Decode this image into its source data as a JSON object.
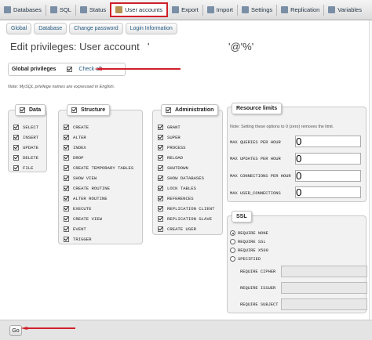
{
  "nav": {
    "tabs": [
      {
        "label": "Databases",
        "icon": "database-icon"
      },
      {
        "label": "SQL",
        "icon": "sql-icon"
      },
      {
        "label": "Status",
        "icon": "status-icon"
      },
      {
        "label": "User accounts",
        "icon": "user-icon"
      },
      {
        "label": "Export",
        "icon": "export-icon"
      },
      {
        "label": "Import",
        "icon": "import-icon"
      },
      {
        "label": "Settings",
        "icon": "wrench-icon"
      },
      {
        "label": "Replication",
        "icon": "replication-icon"
      },
      {
        "label": "Variables",
        "icon": "variables-icon"
      }
    ],
    "active_tab": "User accounts",
    "highlight_color": "#d0202a"
  },
  "subtabs": [
    "Global",
    "Database",
    "Change password",
    "Login Information"
  ],
  "page": {
    "title": "Edit privileges: User account",
    "quote_open": "'",
    "host_part": "'@'%'"
  },
  "global": {
    "label": "Global privileges",
    "check_all": "Check all",
    "note": "Note: MySQL privilege names are expressed in English."
  },
  "groups": {
    "data": {
      "legend": "Data",
      "items": [
        "SELECT",
        "INSERT",
        "UPDATE",
        "DELETE",
        "FILE"
      ]
    },
    "structure": {
      "legend": "Structure",
      "items": [
        "CREATE",
        "ALTER",
        "INDEX",
        "DROP",
        "CREATE TEMPORARY TABLES",
        "SHOW VIEW",
        "CREATE ROUTINE",
        "ALTER ROUTINE",
        "EXECUTE",
        "CREATE VIEW",
        "EVENT",
        "TRIGGER"
      ]
    },
    "administration": {
      "legend": "Administration",
      "items": [
        "GRANT",
        "SUPER",
        "PROCESS",
        "RELOAD",
        "SHUTDOWN",
        "SHOW DATABASES",
        "LOCK TABLES",
        "REFERENCES",
        "REPLICATION CLIENT",
        "REPLICATION SLAVE",
        "CREATE USER"
      ]
    }
  },
  "resource_limits": {
    "legend": "Resource limits",
    "note": "Note: Setting these options to 0 (zero) removes the limit.",
    "rows": [
      "MAX QUERIES PER HOUR",
      "MAX UPDATES PER HOUR",
      "MAX CONNECTIONS PER HOUR",
      "MAX USER_CONNECTIONS"
    ],
    "values": [
      "0",
      "0",
      "0",
      "0"
    ]
  },
  "ssl": {
    "legend": "SSL",
    "options": [
      "REQUIRE NONE",
      "REQUIRE SSL",
      "REQUIRE X509",
      "SPECIFIED"
    ],
    "selected": "REQUIRE NONE",
    "fields": [
      "REQUIRE CIPHER",
      "REQUIRE ISSUER",
      "REQUIRE SUBJECT"
    ]
  },
  "footer": {
    "go_label": "Go"
  }
}
